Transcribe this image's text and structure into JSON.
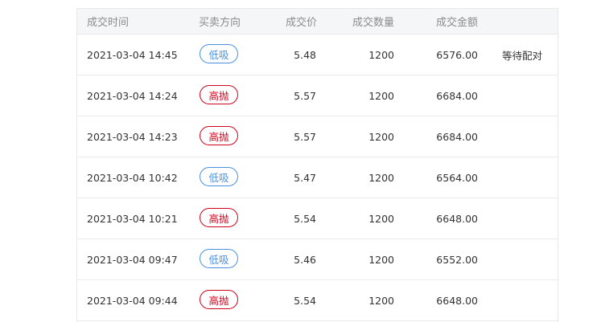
{
  "table": {
    "headers": {
      "time": "成交时间",
      "direction": "买卖方向",
      "price": "成交价",
      "quantity": "成交数量",
      "amount": "成交金额"
    },
    "rows": [
      {
        "time": "2021-03-04 14:45",
        "direction": "低吸",
        "type": "buy",
        "price": "5.48",
        "quantity": "1200",
        "amount": "6576.00",
        "status": "等待配对"
      },
      {
        "time": "2021-03-04 14:24",
        "direction": "高抛",
        "type": "sell",
        "price": "5.57",
        "quantity": "1200",
        "amount": "6684.00",
        "status": ""
      },
      {
        "time": "2021-03-04 14:23",
        "direction": "高抛",
        "type": "sell",
        "price": "5.57",
        "quantity": "1200",
        "amount": "6684.00",
        "status": ""
      },
      {
        "time": "2021-03-04 10:42",
        "direction": "低吸",
        "type": "buy",
        "price": "5.47",
        "quantity": "1200",
        "amount": "6564.00",
        "status": ""
      },
      {
        "time": "2021-03-04 10:21",
        "direction": "高抛",
        "type": "sell",
        "price": "5.54",
        "quantity": "1200",
        "amount": "6648.00",
        "status": ""
      },
      {
        "time": "2021-03-04 09:47",
        "direction": "低吸",
        "type": "buy",
        "price": "5.46",
        "quantity": "1200",
        "amount": "6552.00",
        "status": ""
      },
      {
        "time": "2021-03-04 09:44",
        "direction": "高抛",
        "type": "sell",
        "price": "5.54",
        "quantity": "1200",
        "amount": "6648.00",
        "status": ""
      }
    ]
  },
  "colors": {
    "buy": "#4a90e2",
    "sell": "#d0021b",
    "header_bg": "#f5f6f8"
  }
}
